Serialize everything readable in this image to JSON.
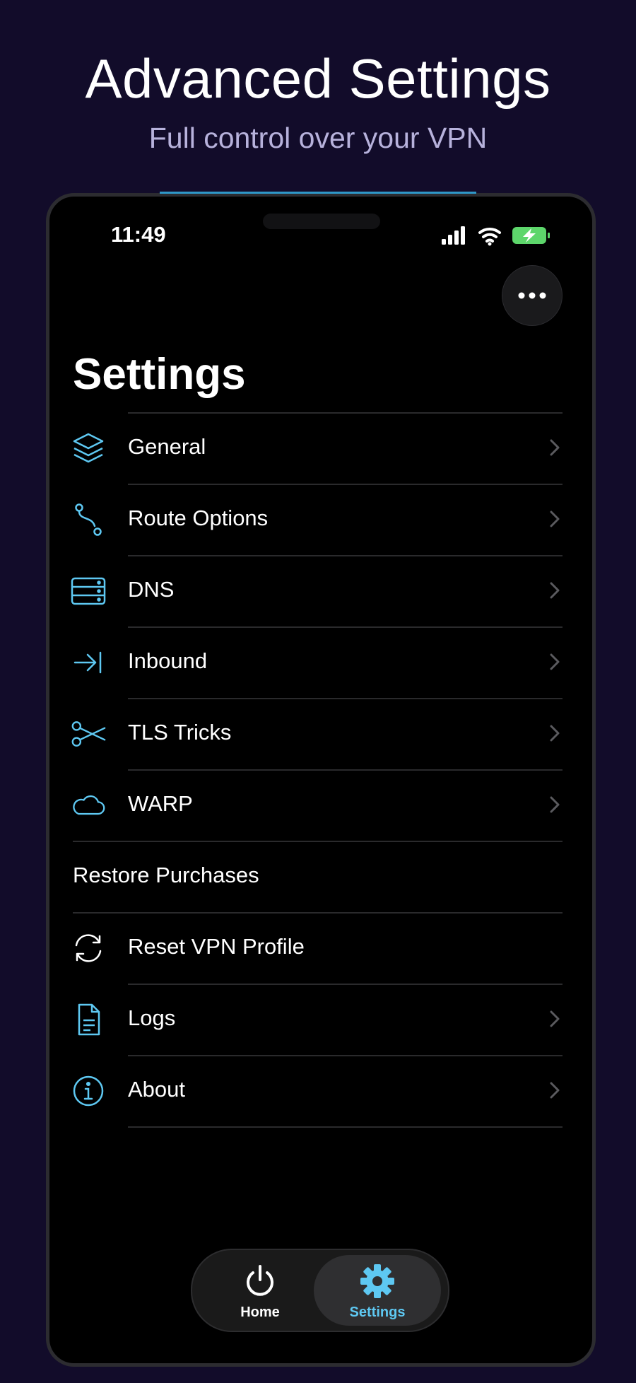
{
  "promo": {
    "title": "Advanced Settings",
    "subtitle": "Full control over your VPN"
  },
  "status_bar": {
    "time": "11:49",
    "icons": [
      "cellular-signal-icon",
      "wifi-icon",
      "battery-charging-icon"
    ]
  },
  "header": {
    "title": "Settings",
    "more_icon": "ellipsis-icon"
  },
  "settings_items": [
    {
      "label": "General",
      "icon": "layers-icon",
      "chevron": true
    },
    {
      "label": "Route Options",
      "icon": "route-icon",
      "chevron": true
    },
    {
      "label": "DNS",
      "icon": "server-icon",
      "chevron": true
    },
    {
      "label": "Inbound",
      "icon": "arrow-to-line-icon",
      "chevron": true
    },
    {
      "label": "TLS Tricks",
      "icon": "scissors-icon",
      "chevron": true
    },
    {
      "label": "WARP",
      "icon": "cloud-icon",
      "chevron": true
    },
    {
      "label": "Restore Purchases",
      "icon": null,
      "chevron": false
    },
    {
      "label": "Reset VPN Profile",
      "icon": "refresh-icon",
      "chevron": false
    },
    {
      "label": "Logs",
      "icon": "document-icon",
      "chevron": true
    },
    {
      "label": "About",
      "icon": "info-icon",
      "chevron": true
    }
  ],
  "tab_bar": {
    "tabs": [
      {
        "label": "Home",
        "icon": "power-icon",
        "active": false
      },
      {
        "label": "Settings",
        "icon": "gear-icon",
        "active": true
      }
    ]
  },
  "colors": {
    "accent": "#5ec8f2",
    "background": "#120c2a",
    "battery": "#5dd66b"
  }
}
